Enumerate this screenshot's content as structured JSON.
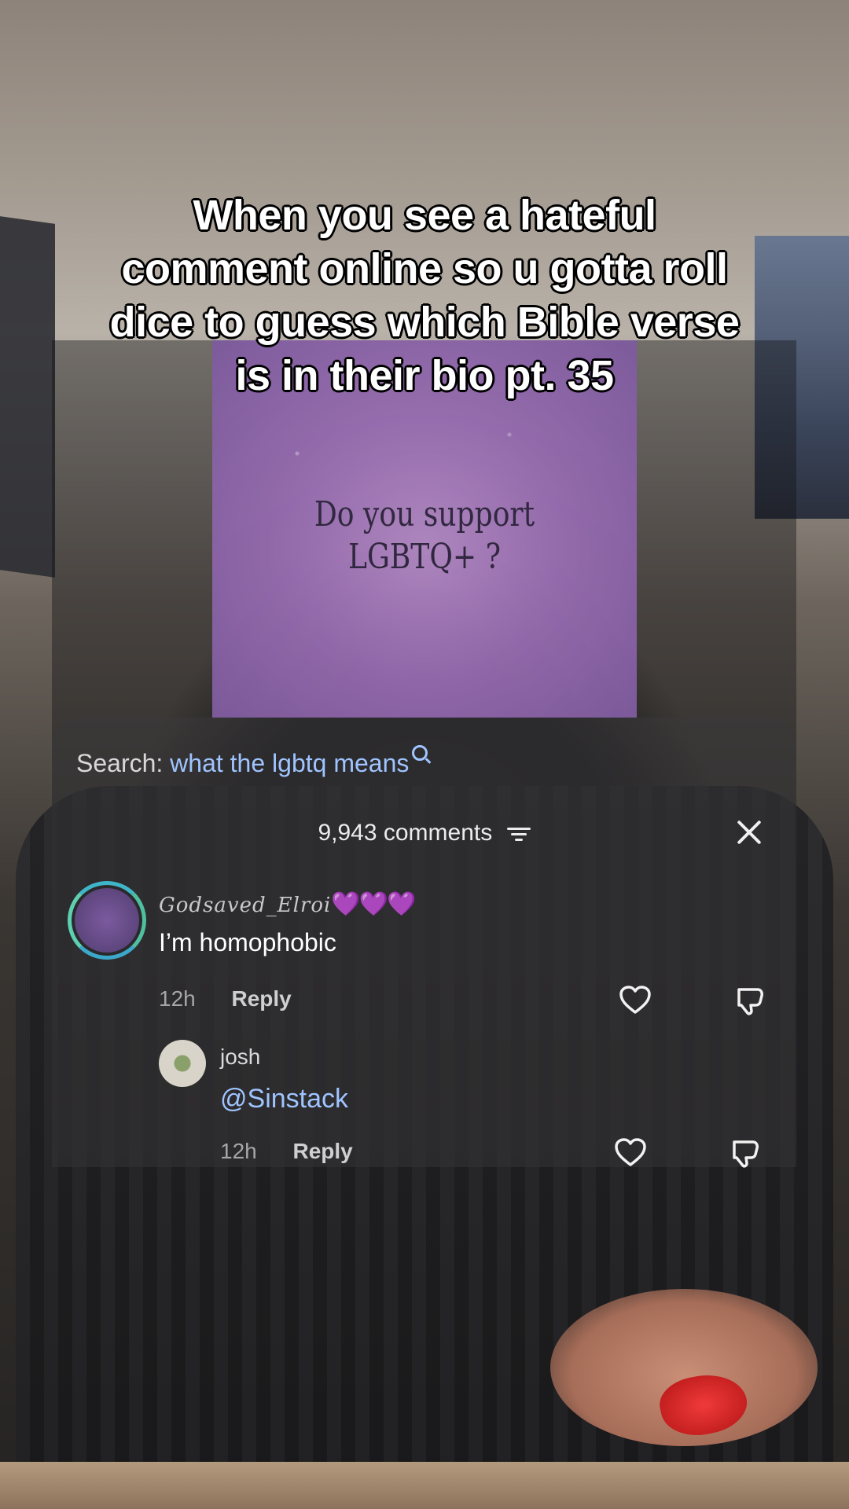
{
  "caption": {
    "line1": "When you see a hateful",
    "line2": "comment online so u gotta roll",
    "line3": "dice to guess which Bible verse",
    "line4": "is in their bio pt. 35"
  },
  "video_thumb": {
    "line1": "Do you support",
    "line2": "LGBTQ+ ?"
  },
  "search": {
    "label": "Search:",
    "query": "what the lgbtq means"
  },
  "comments_header": {
    "count": "9,943 comments"
  },
  "comments": [
    {
      "username": "Godsaved_Elroi",
      "emoji": "💜💜💜",
      "text": "I’m homophobic",
      "time": "12h",
      "reply": "Reply"
    },
    {
      "username": "josh",
      "text": "@Sinstack",
      "time": "12h",
      "reply": "Reply"
    }
  ],
  "colors": {
    "link_blue": "#9fc4ff",
    "heart_purple": "#9b4fe0",
    "avatar_ring": "#3fb6c8"
  },
  "icons": [
    "search-icon",
    "sort-icon",
    "close-icon",
    "heart-icon",
    "dislike-icon"
  ]
}
